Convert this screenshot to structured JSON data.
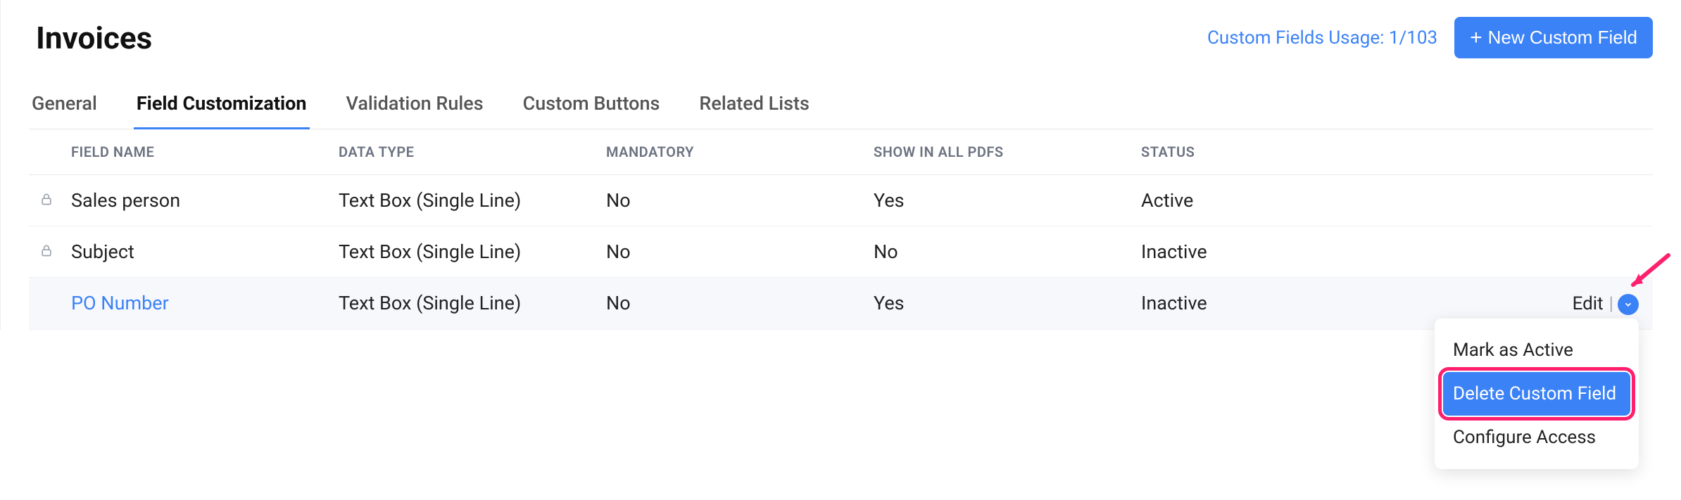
{
  "header": {
    "title": "Invoices",
    "usage_link": "Custom Fields Usage: 1/103",
    "new_button": "New Custom Field"
  },
  "tabs": [
    {
      "label": "General",
      "active": false
    },
    {
      "label": "Field Customization",
      "active": true
    },
    {
      "label": "Validation Rules",
      "active": false
    },
    {
      "label": "Custom Buttons",
      "active": false
    },
    {
      "label": "Related Lists",
      "active": false
    }
  ],
  "columns": {
    "field_name": "FIELD NAME",
    "data_type": "DATA TYPE",
    "mandatory": "MANDATORY",
    "show_pdf": "SHOW IN ALL PDFS",
    "status": "STATUS"
  },
  "rows": [
    {
      "locked": true,
      "name": "Sales person",
      "type": "Text Box (Single Line)",
      "mandatory": "No",
      "pdf": "Yes",
      "status": "Active",
      "hovered": false,
      "is_link": false
    },
    {
      "locked": true,
      "name": "Subject",
      "type": "Text Box (Single Line)",
      "mandatory": "No",
      "pdf": "No",
      "status": "Inactive",
      "hovered": false,
      "is_link": false
    },
    {
      "locked": false,
      "name": "PO Number",
      "type": "Text Box (Single Line)",
      "mandatory": "No",
      "pdf": "Yes",
      "status": "Inactive",
      "hovered": true,
      "is_link": true
    }
  ],
  "row_actions": {
    "edit": "Edit"
  },
  "dropdown": {
    "items": [
      {
        "label": "Mark as Active",
        "highlighted": false
      },
      {
        "label": "Delete Custom Field",
        "highlighted": true
      },
      {
        "label": "Configure Access",
        "highlighted": false
      }
    ]
  }
}
